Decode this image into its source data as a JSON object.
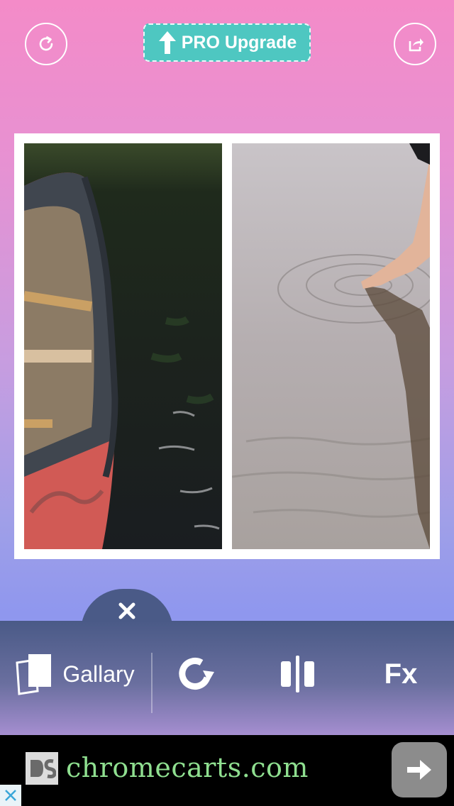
{
  "header": {
    "pro_label": "PRO Upgrade",
    "refresh_icon": "refresh-icon",
    "share_icon": "share-icon"
  },
  "collage": {
    "cells": [
      {
        "subject": "red canoe on dark water"
      },
      {
        "subject": "hand touching rippling water"
      }
    ]
  },
  "toolbar": {
    "close_icon": "close-icon",
    "gallery_label": "Gallary",
    "rotate_icon": "rotate-icon",
    "split_icon": "split-layout-icon",
    "fx_label": "Fx"
  },
  "ad": {
    "text": "chromecarts.com",
    "arrow_icon": "arrow-right-icon",
    "close_icon": "close-icon"
  },
  "colors": {
    "accent": "#4ec7c1",
    "toolbar": "#4a5a87",
    "ad_text": "#8fdf90"
  }
}
